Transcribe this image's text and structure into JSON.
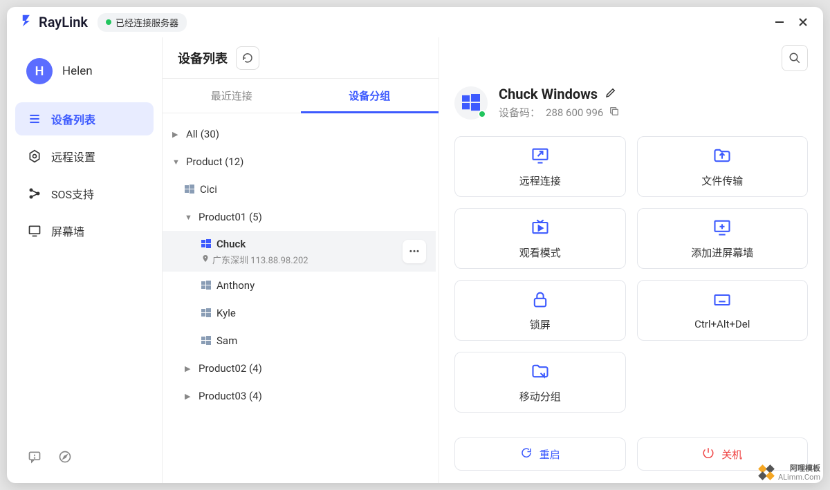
{
  "app": {
    "name": "RayLink",
    "status": "已经连接服务器"
  },
  "user": {
    "initial": "H",
    "name": "Helen"
  },
  "nav": {
    "devices": "设备列表",
    "remote_settings": "远程设置",
    "sos": "SOS支持",
    "screen_wall": "屏幕墙"
  },
  "mid": {
    "title": "设备列表",
    "tab_recent": "最近连接",
    "tab_groups": "设备分组"
  },
  "tree": {
    "all": "All (30)",
    "product": "Product (12)",
    "cici": "Cici",
    "product01": "Product01 (5)",
    "chuck": "Chuck",
    "chuck_loc": "广东深圳 113.88.98.202",
    "anthony": "Anthony",
    "kyle": "Kyle",
    "sam": "Sam",
    "product02": "Product02 (4)",
    "product03": "Product03 (4)"
  },
  "detail": {
    "name": "Chuck Windows",
    "code_label": "设备码：",
    "code": "288 600 996",
    "actions": {
      "remote": "远程连接",
      "file": "文件传输",
      "watch": "观看模式",
      "wall": "添加进屏幕墙",
      "lock": "锁屏",
      "cad": "Ctrl+Alt+Del",
      "move": "移动分组"
    },
    "restart": "重启",
    "shutdown": "关机"
  },
  "watermark": {
    "line1": "阿哩模板",
    "line2": "ALimm.Com"
  }
}
